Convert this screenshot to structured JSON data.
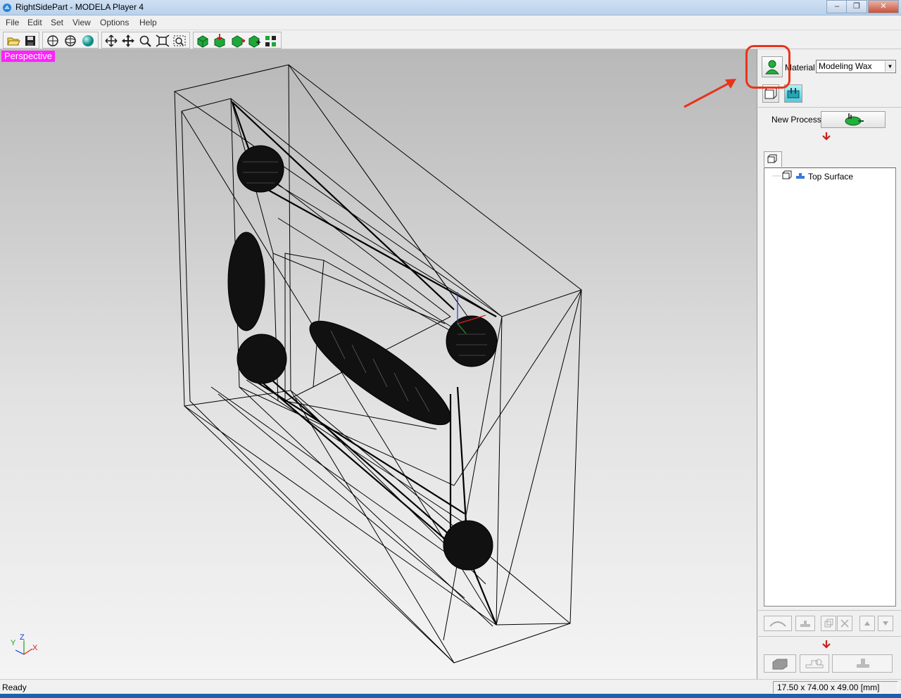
{
  "window": {
    "title": "RightSidePart - MODELA Player 4",
    "controls": {
      "minimize": "–",
      "restore": "❐",
      "close": "✕"
    }
  },
  "menu": {
    "items": [
      "File",
      "Edit",
      "Set",
      "View",
      "Options",
      "Help"
    ]
  },
  "toolbar": {
    "buttons": [
      "open-icon",
      "save-icon",
      "rotate-icon",
      "orbit-icon",
      "sphere-icon",
      "move-icon",
      "pan-icon",
      "zoom-icon",
      "fit-icon",
      "zoom-box-icon",
      "box-green-icon",
      "box-down-icon",
      "box-side-icon",
      "box-cut-icon",
      "grid-icon"
    ]
  },
  "viewport": {
    "view_label": "Perspective",
    "axes": {
      "z": "Z",
      "y": "Y",
      "x": "X"
    }
  },
  "panel": {
    "material_label": "Material",
    "material_value": "Modeling Wax",
    "new_process_label": "New Process",
    "tree": {
      "items": [
        {
          "label": "Top Surface"
        }
      ]
    }
  },
  "colors": {
    "perspective_badge": "#ff22ff",
    "highlight": "#e8341c",
    "down_arrow": "#cc1f1f",
    "annotation_arrow": "#e8341c"
  },
  "status": {
    "text": "Ready",
    "dimensions": "17.50 x 74.00 x 49.00 [mm]"
  }
}
